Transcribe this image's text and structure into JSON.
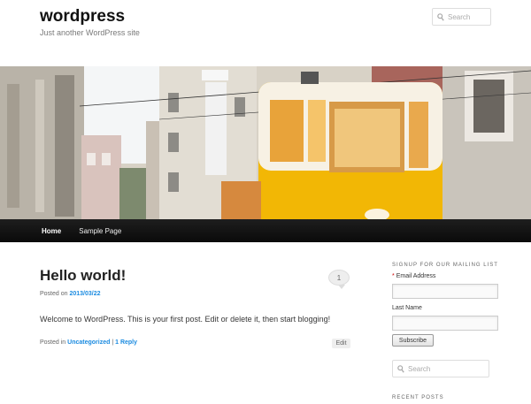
{
  "site": {
    "title": "wordpress",
    "description": "Just another WordPress site"
  },
  "header_search": {
    "placeholder": "Search"
  },
  "nav": {
    "items": [
      {
        "label": "Home"
      },
      {
        "label": "Sample Page"
      }
    ]
  },
  "post": {
    "title": "Hello world!",
    "comment_count": "1",
    "posted_on_prefix": "Posted on",
    "date": "2013/03/22",
    "body": "Welcome to WordPress. This is your first post. Edit or delete it, then start blogging!",
    "posted_in_prefix": "Posted in",
    "category": "Uncategorized",
    "separator": "|",
    "reply_link": "1 Reply",
    "edit_label": "Edit"
  },
  "sidebar": {
    "mailing_heading": "Signup for our mailing list",
    "email_required_mark": "*",
    "email_label": "Email Address",
    "lastname_label": "Last Name",
    "subscribe_label": "Subscribe",
    "search_placeholder": "Search",
    "recent_heading": "Recent Posts"
  },
  "colors": {
    "link": "#1b8be0",
    "nav_background": "#111111",
    "tram_yellow": "#f2b705"
  },
  "icons": {
    "search": "search-icon"
  }
}
